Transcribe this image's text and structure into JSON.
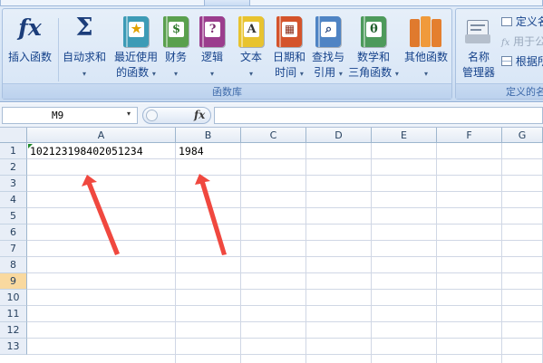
{
  "ribbon": {
    "buttons": {
      "insert_function": {
        "label": "插入函数",
        "icon": "fx-icon"
      },
      "autosum": {
        "label1": "自动求和",
        "icon": "sigma-icon"
      },
      "recent": {
        "label1": "最近使用",
        "label2": "的函数",
        "icon": "star-book-icon"
      },
      "financial": {
        "label1": "财务",
        "icon": "finance-book-icon"
      },
      "logical": {
        "label1": "逻辑",
        "icon": "question-book-icon"
      },
      "text": {
        "label1": "文本",
        "icon": "text-book-icon"
      },
      "datetime": {
        "label1": "日期和",
        "label2": "时间",
        "icon": "calendar-book-icon"
      },
      "lookup": {
        "label1": "查找与",
        "label2": "引用",
        "icon": "magnifier-book-icon"
      },
      "math": {
        "label1": "数学和",
        "label2": "三角函数",
        "icon": "theta-book-icon"
      },
      "more": {
        "label1": "其他函数",
        "icon": "books-icon"
      },
      "name_manager": {
        "label1": "名称",
        "label2": "管理器",
        "icon": "name-tag-icon"
      }
    },
    "glyphs": {
      "fx": "fx",
      "sigma": "Σ",
      "recent": "★",
      "financial": "$",
      "logical": "?",
      "text": "A",
      "datetime": "▦",
      "lookup": "⌕",
      "math": "θ"
    },
    "caret": "▾",
    "small_buttons": {
      "define_name": "定义名",
      "use_in_formula": "用于公",
      "create_from_selection": "根据所"
    },
    "group_label_library": "函数库",
    "group_label_names": "定义的名"
  },
  "formula_bar": {
    "name_box": "M9",
    "fx_label": "fx",
    "formula": ""
  },
  "sheet": {
    "columns": [
      "A",
      "B",
      "C",
      "D",
      "E",
      "F",
      "G"
    ],
    "rows": [
      "1",
      "2",
      "3",
      "4",
      "5",
      "6",
      "7",
      "8",
      "9",
      "10",
      "11",
      "12",
      "13"
    ],
    "active_row": "9",
    "cells": {
      "A1": "102123198402051234",
      "B1": "1984"
    }
  },
  "colors": {
    "arrow": "#f0483f",
    "active_row": "#f9d99f",
    "ribbon": "#d4e3f5"
  }
}
